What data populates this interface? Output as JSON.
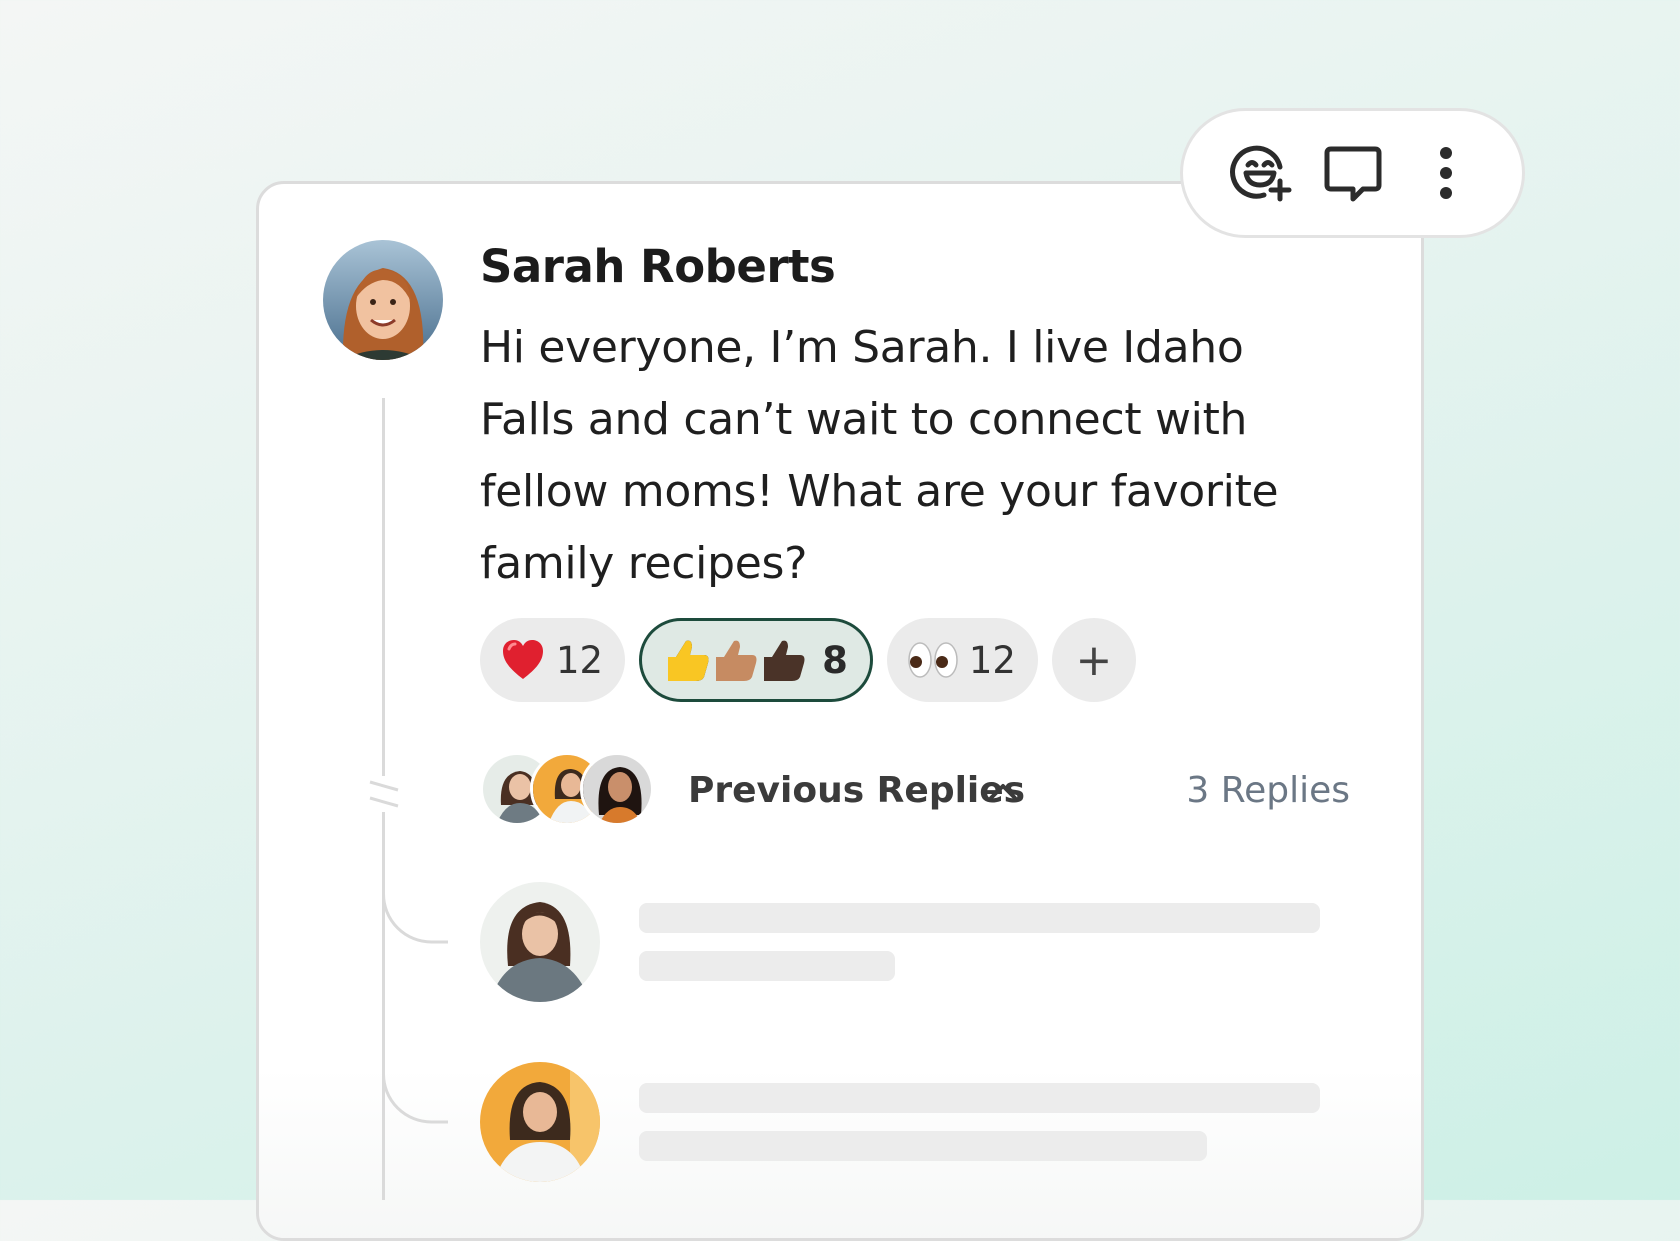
{
  "post": {
    "author": "Sarah Roberts",
    "message": "Hi everyone, I’m Sarah. I live Idaho Falls and can’t wait to connect with fellow moms! What are your favorite family recipes?"
  },
  "toolbar": {
    "icons": [
      "add-reaction-icon",
      "comment-icon",
      "more-vertical-icon"
    ]
  },
  "reactions": [
    {
      "emoji": "❤️",
      "count": "12",
      "active": false
    },
    {
      "emoji": "👍👍🏽👍🏿",
      "count": "8",
      "active": true
    },
    {
      "emoji": "👀",
      "count": "12",
      "active": false
    }
  ],
  "add_reaction_label": "+",
  "replies": {
    "label": "Previous Replies",
    "count_label": "3 Replies",
    "expanded": true
  },
  "colors": {
    "accent": "#1d4b3c",
    "card_border": "#dcdcdc",
    "skeleton": "#ececec",
    "muted_text": "#6b7785"
  }
}
